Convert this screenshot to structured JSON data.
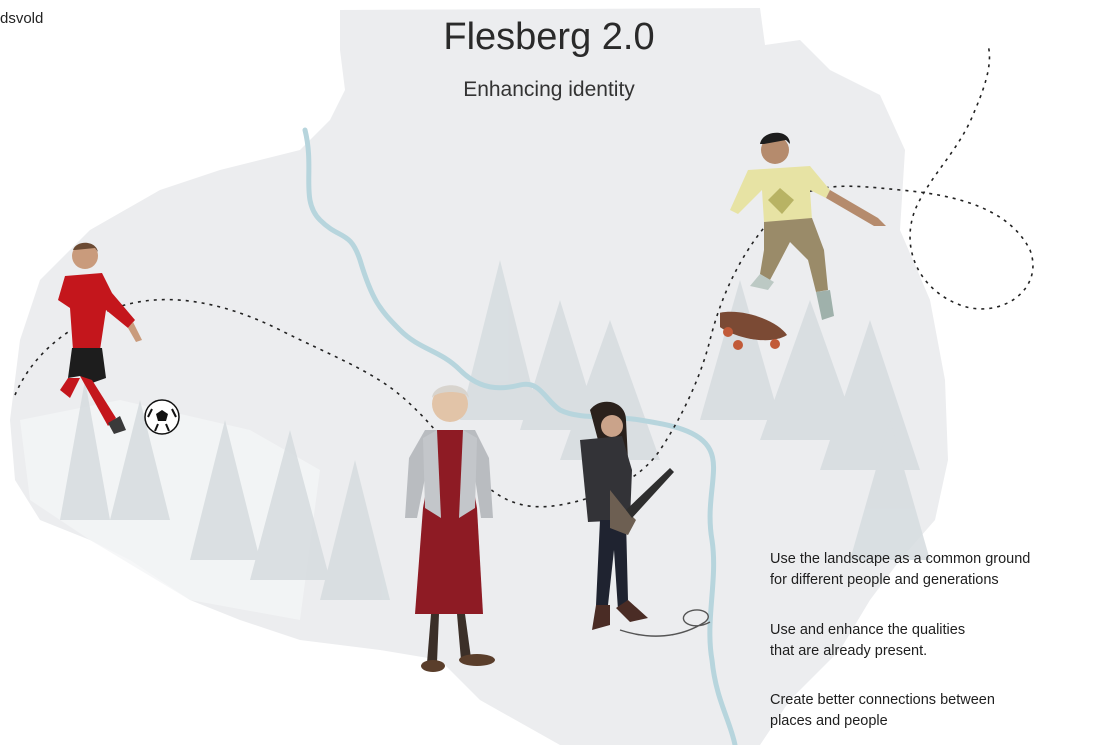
{
  "corner_label": "dsvold",
  "title": "Flesberg 2.0",
  "subtitle": "Enhancing identity",
  "statements": [
    {
      "line1": "Use the landscape as a common ground",
      "line2": "for different people and generations"
    },
    {
      "line1": "Use and enhance the qualities",
      "line2": "that are already present."
    },
    {
      "line1": "Create better connections between",
      "line2": "places and people"
    }
  ],
  "colors": {
    "map": "#eceeef",
    "river": "#b9d6de",
    "trees": "#d9dfe1",
    "path": "#222222",
    "red_shirt": "#c4161c",
    "dress": "#8e1b24"
  },
  "figures": [
    "football-player",
    "elderly-woman",
    "guitarist",
    "skateboarder"
  ]
}
